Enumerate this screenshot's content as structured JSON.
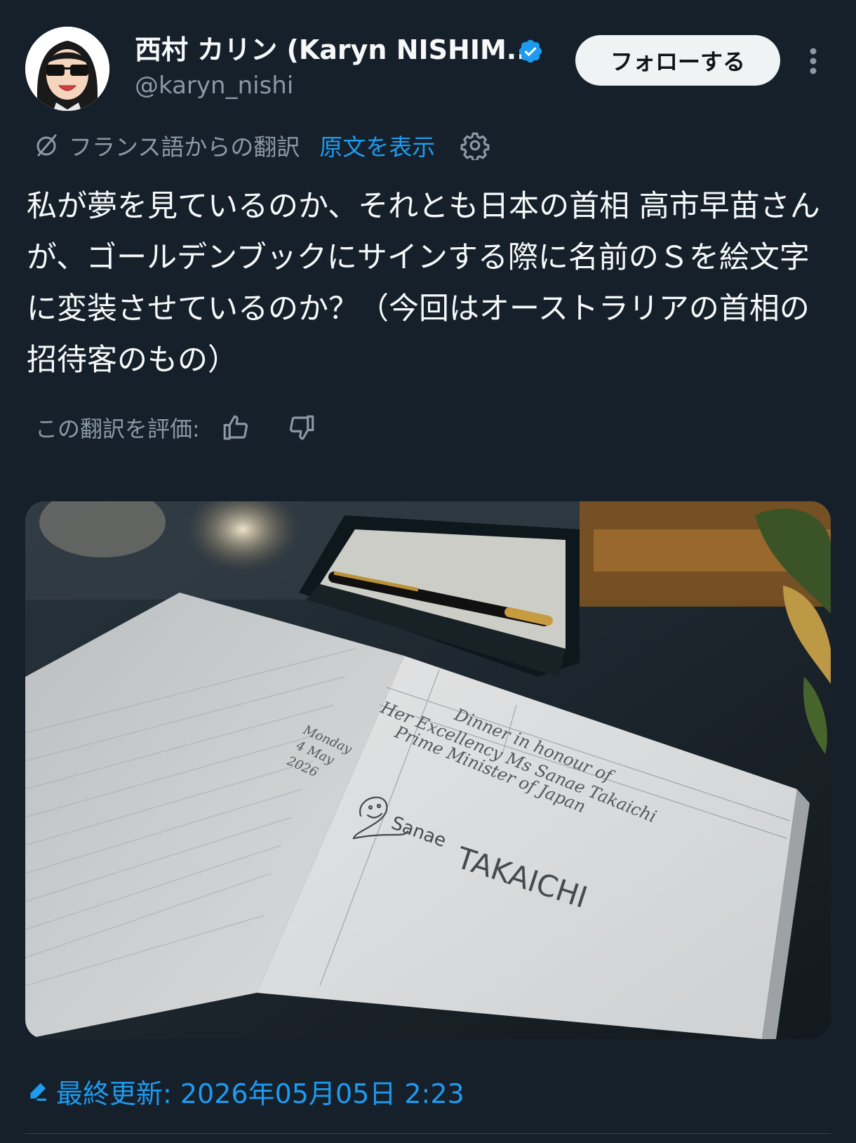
{
  "author": {
    "display_name": "西村 カリン (Karyn NISHIM...",
    "handle": "@karyn_nishi",
    "verified": true,
    "avatar_icon": "avatar-cartoon-woman-sunglasses"
  },
  "actions": {
    "follow_label": "フォローする",
    "more_icon": "more-vertical-icon"
  },
  "translation": {
    "translated_from": "フランス語からの翻訳",
    "show_original": "原文を表示",
    "settings_icon": "gear-icon"
  },
  "tweet": {
    "text": "私が夢を見ているのか、それとも日本の首相 高市早苗さんが、ゴールデンブックにサインする際に名前のＳを絵文字に変装させているのか？（今回はオーストラリアの首相の招待客のもの）"
  },
  "rating": {
    "label": "この翻訳を評価:",
    "like_icon": "thumbs-up-icon",
    "dislike_icon": "thumbs-down-icon"
  },
  "photo": {
    "book_lines": {
      "date_day": "Monday",
      "date_month": "4 May",
      "date_year": "2026",
      "line1": "Dinner in honour of",
      "line2": "Her Excellency Ms Sanae Takaichi",
      "line3": "Prime Minister of Japan",
      "signature_first": "Sanae",
      "signature_last": "TAKAICHI"
    }
  },
  "footer": {
    "updated": "最終更新: 2026年05月05日 2:23"
  },
  "colors": {
    "background": "#15202b",
    "accent": "#1d9bf0",
    "muted": "#8b98a5",
    "text": "#f7f9f9"
  }
}
